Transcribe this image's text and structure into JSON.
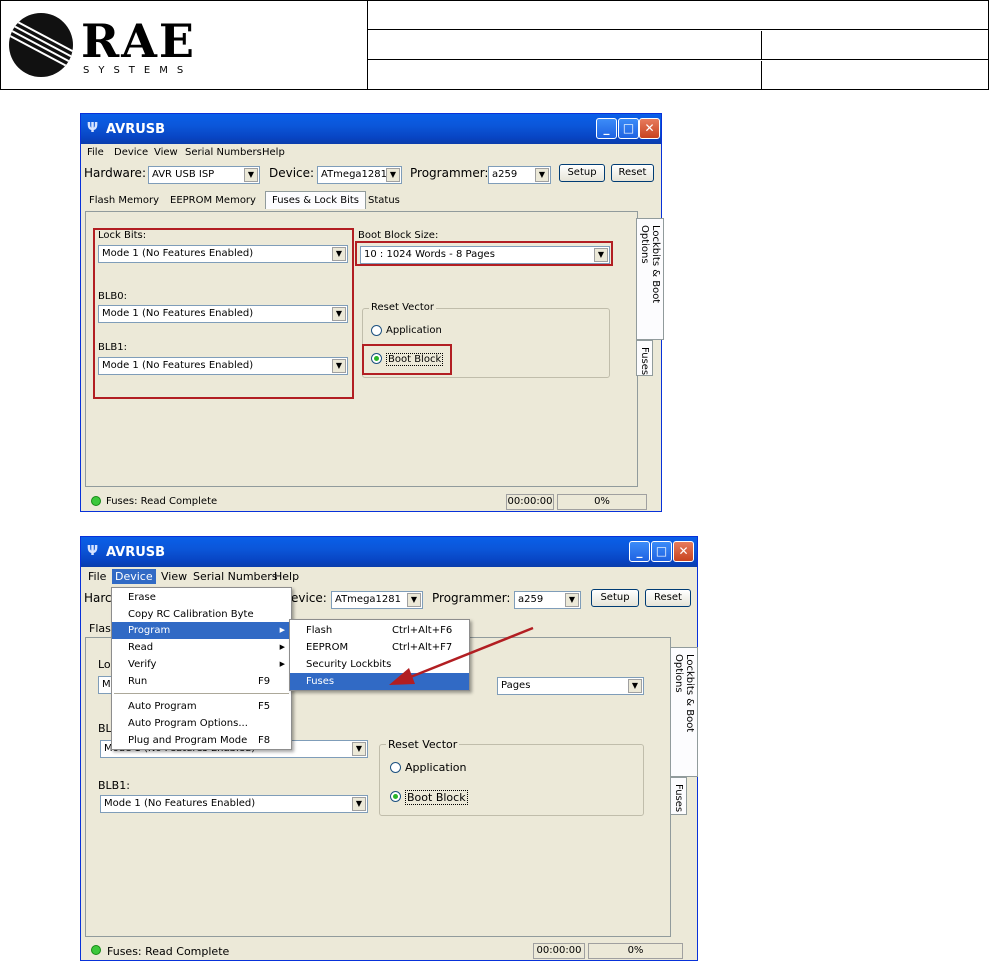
{
  "doc_header": {
    "logo_text": "RAE",
    "logo_subtext": "SYSTEMS"
  },
  "window1": {
    "title": "AVRUSB",
    "menu": [
      "File",
      "Device",
      "View",
      "Serial Numbers",
      "Help"
    ],
    "hardware_label": "Hardware:",
    "hardware_value": "AVR USB ISP",
    "device_label": "Device:",
    "device_value": "ATmega1281",
    "programmer_label": "Programmer:",
    "programmer_value": "a259",
    "setup_label": "Setup",
    "reset_label": "Reset",
    "tabs": [
      "Flash Memory",
      "EEPROM Memory",
      "Fuses & Lock Bits",
      "Status"
    ],
    "lock_bits_label": "Lock Bits:",
    "lock_bits_value": "Mode 1 (No Features Enabled)",
    "blb0_label": "BLB0:",
    "blb0_value": "Mode 1 (No Features Enabled)",
    "blb1_label": "BLB1:",
    "blb1_value": "Mode 1 (No Features Enabled)",
    "boot_block_label": "Boot Block Size:",
    "boot_block_value": "10 : 1024 Words - 8 Pages",
    "reset_vector_label": "Reset Vector",
    "radio_application": "Application",
    "radio_boot_block": "Boot Block",
    "vtab_lockbits": "Lockbits & Boot Options",
    "vtab_fuses": "Fuses",
    "status_text": "Fuses: Read Complete",
    "status_time": "00:00:00",
    "status_percent": "0%"
  },
  "window2": {
    "title": "AVRUSB",
    "menu": [
      "File",
      "Device",
      "View",
      "Serial Numbers",
      "Help"
    ],
    "hardware_label_partial": "Harc",
    "device_label_partial": "evice:",
    "device_value": "ATmega1281",
    "programmer_label": "Programmer:",
    "programmer_value": "a259",
    "setup_label": "Setup",
    "reset_label": "Reset",
    "tab_partial": "Flash",
    "lock_label_partial": "Lo",
    "lock_value_partial": "Mo",
    "blb0_label_partial": "BLB",
    "blb0_value": "Mode 1 (No Features Enabled)",
    "blb1_label": "BLB1:",
    "blb1_value": "Mode 1 (No Features Enabled)",
    "boot_block_value_partial": "Pages",
    "reset_vector_label": "Reset Vector",
    "radio_application": "Application",
    "radio_boot_block": "Boot Block",
    "vtab_lockbits": "Lockbits & Boot Options",
    "vtab_fuses": "Fuses",
    "status_text": "Fuses: Read Complete",
    "status_time": "00:00:00",
    "status_percent": "0%",
    "device_menu": {
      "items": [
        {
          "label": "Erase",
          "accel": ""
        },
        {
          "label": "Copy RC Calibration Byte",
          "accel": ""
        },
        {
          "label": "Program",
          "accel": "",
          "submenu": true
        },
        {
          "label": "Read",
          "accel": "",
          "submenu": true
        },
        {
          "label": "Verify",
          "accel": "",
          "submenu": true
        },
        {
          "label": "Run",
          "accel": "F9"
        },
        {
          "label": "Auto Program",
          "accel": "F5"
        },
        {
          "label": "Auto Program Options...",
          "accel": ""
        },
        {
          "label": "Plug and Program Mode",
          "accel": "F8"
        }
      ]
    },
    "program_submenu": {
      "items": [
        {
          "label": "Flash",
          "accel": "Ctrl+Alt+F6"
        },
        {
          "label": "EEPROM",
          "accel": "Ctrl+Alt+F7"
        },
        {
          "label": "Security Lockbits",
          "accel": ""
        },
        {
          "label": "Fuses",
          "accel": ""
        }
      ]
    }
  },
  "colors": {
    "highlight_box": "#b21e22",
    "menu_selection": "#316ac5",
    "titlebar": "#0a5fe8"
  }
}
